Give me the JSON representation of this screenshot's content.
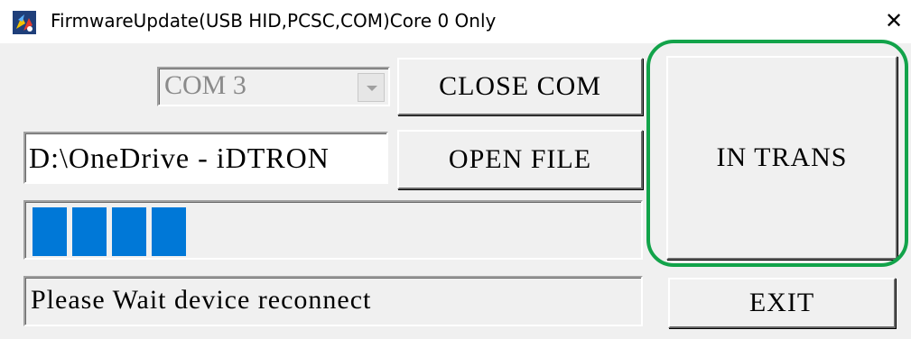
{
  "window": {
    "title": "FirmwareUpdate(USB HID,PCSC,COM)Core 0 Only",
    "close_glyph": "✕"
  },
  "port_select": {
    "value": "COM 3"
  },
  "buttons": {
    "close_com": "CLOSE COM",
    "open_file": "OPEN FILE",
    "in_trans": "IN TRANS",
    "exit": "EXIT"
  },
  "file_path": {
    "value": "D:\\OneDrive - iDTRON"
  },
  "progress": {
    "value": 0.23,
    "blocks_filled": 4
  },
  "status": {
    "text": "Please Wait device reconnect"
  },
  "highlight_color": "#12a34a",
  "accent": "#0078d7"
}
